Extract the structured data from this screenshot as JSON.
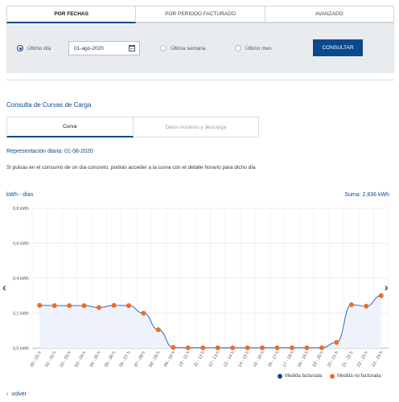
{
  "tabs": [
    {
      "label": "POR FECHAS",
      "active": true
    },
    {
      "label": "POR PERIODO FACTURADO",
      "active": false
    },
    {
      "label": "AVANZADO",
      "active": false
    }
  ],
  "filter": {
    "radio_ultimo_dia": "Último día",
    "date_value": "01-ago-2020",
    "radio_ultima_semana": "Última semana",
    "radio_ultimo_mes": "Último mes",
    "consultar_label": "CONSULTAR",
    "selected": "Último día"
  },
  "section_title": "Consulta de Curvas de Carga",
  "subtabs": [
    {
      "label": "Curva",
      "active": true
    },
    {
      "label": "Datos horarios y descarga",
      "active": false
    }
  ],
  "representation_title": "Representación diaria: 01-08-2020",
  "hint_text": "Si pulsas en el consumo de un día concreto, podrás acceder a la curva con el detalle horario para dicho día",
  "units_label": "kWh - días",
  "sum_label": "Suma: 2,836 kWh",
  "volver_label": "volver",
  "colors": {
    "accent": "#0a4a8c",
    "facturada": "#1f3f8f",
    "no_facturada": "#f06a22",
    "area_fill": "#eef2fb",
    "line": "#3a63c8"
  },
  "chart_data": {
    "type": "line",
    "categories": [
      "00 - 01 h",
      "01 - 02 h",
      "02 - 03 h",
      "03 - 04 h",
      "04 - 05 h",
      "05 - 06 h",
      "06 - 07 h",
      "07 - 08 h",
      "08 - 09 h",
      "09 - 10 h",
      "10 - 11 h",
      "11 - 12 h",
      "12 - 13 h",
      "13 - 14 h",
      "14 - 15 h",
      "15 - 16 h",
      "16 - 17 h",
      "17 - 18 h",
      "18 - 19 h",
      "19 - 20 h",
      "20 - 21 h",
      "21 - 22 h",
      "22 - 23 h",
      "23 - 24 h"
    ],
    "values": [
      0.245,
      0.243,
      0.243,
      0.243,
      0.232,
      0.245,
      0.243,
      0.2,
      0.105,
      0.004,
      0.002,
      0.002,
      0.002,
      0.002,
      0.002,
      0.002,
      0.002,
      0.002,
      0.002,
      0.002,
      0.033,
      0.248,
      0.24,
      0.3
    ],
    "yticks": [
      "0,0 kWh",
      "0,2 kWh",
      "0,4 kWh",
      "0,6 kWh",
      "0,8 kWh"
    ],
    "ylim": [
      0,
      0.8
    ],
    "grid": true,
    "legend": [
      {
        "name": "Medida facturada"
      },
      {
        "name": "Medida no facturada"
      }
    ],
    "legend_position": "bottom-right"
  }
}
